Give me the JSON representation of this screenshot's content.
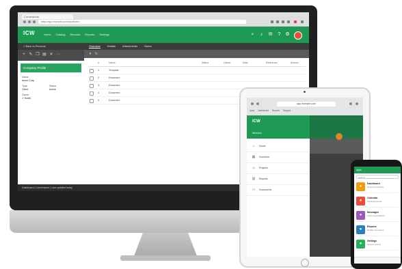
{
  "colors": {
    "brand_green": "#1f9a55",
    "dark_bar": "#3a3b3c",
    "avatar_red": "#e74c3c"
  },
  "desktop": {
    "browser": {
      "tab_label": "Cornerstone",
      "url": "https://app.example.com/dashboard"
    },
    "header": {
      "logo": "ICW",
      "logo_sub": "",
      "nav": [
        "Home",
        "Catalog",
        "Records",
        "Reports",
        "Settings"
      ],
      "icons": [
        "search-icon",
        "bell-icon",
        "mail-icon",
        "help-icon",
        "gear-icon"
      ]
    },
    "subbar": {
      "back": "< Back to Records",
      "tabs": [
        "Overview",
        "Details",
        "Attachments",
        "Notes"
      ]
    },
    "left_panel": {
      "title": "Company Profile",
      "fields": [
        {
          "label": "Name",
          "value": "Acme Corp"
        },
        {
          "label": "Type",
          "value": "Client"
        },
        {
          "label": "Status",
          "value": "Active"
        },
        {
          "label": "Owner",
          "value": "J. Smith"
        }
      ]
    },
    "table": {
      "headers": [
        "",
        "#",
        "Name",
        "Status",
        "Owner",
        "Date",
        "Reference",
        "Actions"
      ],
      "rows": [
        {
          "num": "1",
          "name": "Template"
        },
        {
          "num": "2",
          "name": "Document"
        },
        {
          "num": "3",
          "name": "Document"
        },
        {
          "num": "4",
          "name": "Document"
        },
        {
          "num": "5",
          "name": "Document"
        }
      ]
    },
    "footer": "Dashboard  |  Cornerstone  |  Last updated today"
  },
  "tablet": {
    "url": "app.example.com",
    "bookmarks": [
      "Apps",
      "Dashboard",
      "Reports",
      "Support"
    ],
    "logo": "ICW",
    "user": "Welcome",
    "menu": [
      {
        "icon": "home-icon",
        "label": "Home"
      },
      {
        "icon": "calendar-icon",
        "label": "Schedule"
      },
      {
        "icon": "people-icon",
        "label": "Projects"
      },
      {
        "icon": "chart-icon",
        "label": "Reports"
      },
      {
        "icon": "folder-icon",
        "label": "Documents"
      }
    ]
  },
  "phone": {
    "header": "Apps",
    "search": "Search",
    "cards": [
      {
        "title": "Dashboard",
        "desc": "Overview of activity",
        "color": "#f39c12"
      },
      {
        "title": "Calendar",
        "desc": "Upcoming events",
        "color": "#e74c3c"
      },
      {
        "title": "Messages",
        "desc": "Latest conversations",
        "color": "#9b59b6"
      },
      {
        "title": "Reports",
        "desc": "Monthly summaries",
        "color": "#2980b9"
      },
      {
        "title": "Settings",
        "desc": "Account options",
        "color": "#27ae60"
      }
    ]
  }
}
